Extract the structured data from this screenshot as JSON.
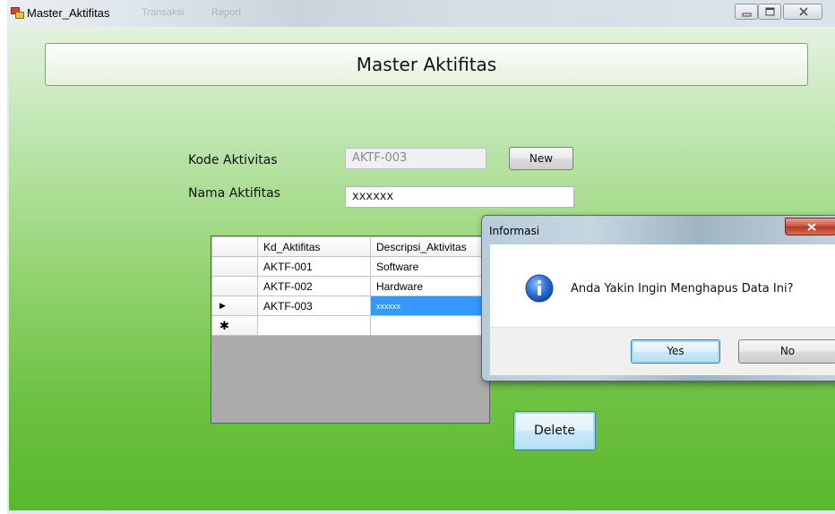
{
  "window": {
    "title": "Master_Aktifitas",
    "ghost_tabs": [
      "Transaksi",
      "Report"
    ],
    "controls": {
      "minimize": "minimize",
      "maximize": "maximize",
      "close": "close"
    }
  },
  "header": {
    "title": "Master Aktifitas"
  },
  "form": {
    "kode_label": "Kode Aktivitas",
    "kode_value": "AKTF-003",
    "new_button": "New",
    "nama_label": "Nama Aktifitas",
    "nama_value": "xxxxxx"
  },
  "grid": {
    "columns": [
      "Kd_Aktifitas",
      "Descripsi_Aktivitas"
    ],
    "rows": [
      {
        "indicator": "",
        "kd": "AKTF-001",
        "desc": "Software"
      },
      {
        "indicator": "▶",
        "kd": "AKTF-002",
        "desc": "Hardware"
      },
      {
        "indicator": "▶",
        "kd": "AKTF-003",
        "desc": "xxxxxx"
      },
      {
        "indicator": "✱",
        "kd": "",
        "desc": ""
      }
    ]
  },
  "delete_button": "Delete",
  "dialog": {
    "title": "Informasi",
    "message": "Anda Yakin Ingin Menghapus Data Ini?",
    "yes": "Yes",
    "no": "No",
    "icon": "info-icon"
  },
  "colors": {
    "form_gradient_top": "#e4f2df",
    "form_gradient_bottom": "#59b82c",
    "selection": "#3399ff"
  }
}
